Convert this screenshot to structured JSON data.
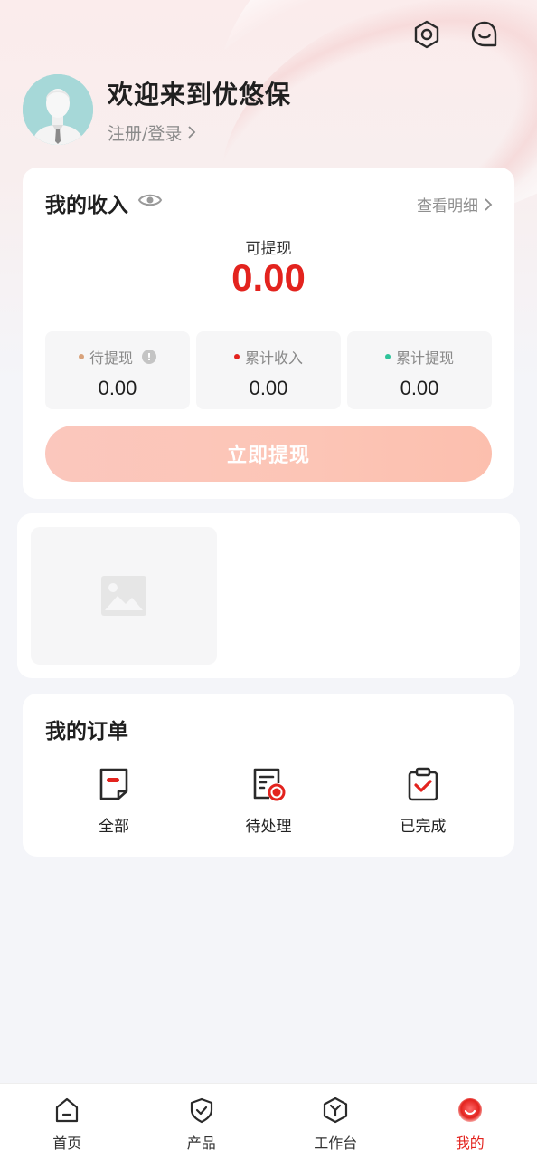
{
  "header": {
    "welcome": "欢迎来到优悠保",
    "login_link": "注册/登录"
  },
  "income": {
    "title": "我的收入",
    "detail_link": "查看明细",
    "withdrawable_label": "可提现",
    "withdrawable_value": "0.00",
    "stats": [
      {
        "label": "待提现",
        "value": "0.00",
        "dot_color": "#d8a27b"
      },
      {
        "label": "累计收入",
        "value": "0.00",
        "dot_color": "#e3231e"
      },
      {
        "label": "累计提现",
        "value": "0.00",
        "dot_color": "#2fc39a"
      }
    ],
    "info_badge": "!",
    "withdraw_button": "立即提现"
  },
  "orders": {
    "title": "我的订单",
    "items": [
      {
        "label": "全部",
        "icon": "document-icon"
      },
      {
        "label": "待处理",
        "icon": "pending-list-icon"
      },
      {
        "label": "已完成",
        "icon": "clipboard-check-icon"
      }
    ]
  },
  "tabbar": {
    "tabs": [
      {
        "label": "首页",
        "icon": "home-icon"
      },
      {
        "label": "产品",
        "icon": "shield-check-icon"
      },
      {
        "label": "工作台",
        "icon": "workbench-icon"
      },
      {
        "label": "我的",
        "icon": "profile-icon",
        "active": true
      }
    ]
  },
  "colors": {
    "accent": "#e3231e",
    "button_gradient_start": "#fbc7bd",
    "button_gradient_end": "#fcbfae",
    "background": "#f4f5f9"
  }
}
